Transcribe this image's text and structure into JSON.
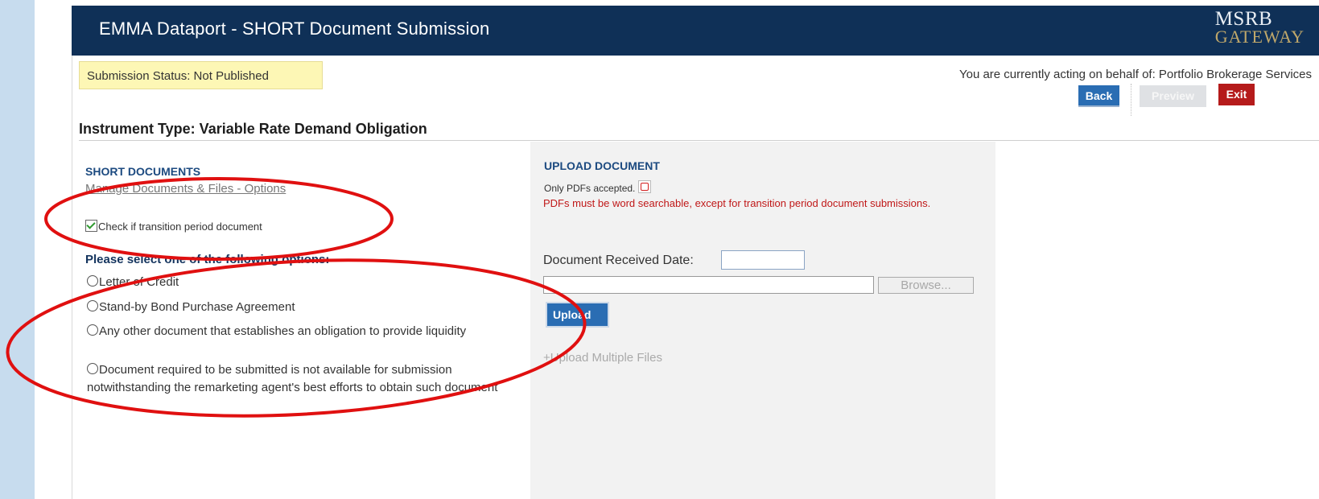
{
  "header": {
    "title": "EMMA Dataport - SHORT Document Submission",
    "logo_top": "MSRB",
    "logo_bottom": "GATEWAY"
  },
  "status": {
    "submission_status": "Submission Status: Not Published",
    "behalf": "You are currently acting on behalf of: Portfolio Brokerage Services"
  },
  "toolbar": {
    "back_label": "Back",
    "preview_label": "Preview",
    "exit_label": "Exit"
  },
  "instrument_type": "Instrument Type: Variable Rate Demand Obligation",
  "short_documents": {
    "title": "SHORT DOCUMENTS",
    "manage_link": "Manage Documents & Files - Options",
    "transition_checkbox_label": "Check if transition period document",
    "transition_checked": true,
    "options_heading": "Please select one of the following options:",
    "options": [
      "Letter of Credit",
      "Stand-by Bond Purchase Agreement",
      "Any other document that establishes an obligation to provide liquidity",
      "Document required to be submitted is not available for submission notwithstanding the remarketing agent's best efforts to obtain such document"
    ]
  },
  "upload": {
    "title": "UPLOAD DOCUMENT",
    "pdfs_only": "Only PDFs accepted.",
    "pdf_note": "PDFs must be word searchable, except for transition period document submissions.",
    "date_label": "Document Received Date:",
    "date_value": "",
    "file_value": "",
    "browse_label": "Browse...",
    "upload_label": "Upload",
    "multiple_link": "+Upload Multiple Files"
  },
  "colors": {
    "header_bg": "#0f3057",
    "accent_blue": "#2a6db3",
    "exit_red": "#b51b1b",
    "status_yellow": "#fdf7b5",
    "annotation_red": "#e01010"
  }
}
